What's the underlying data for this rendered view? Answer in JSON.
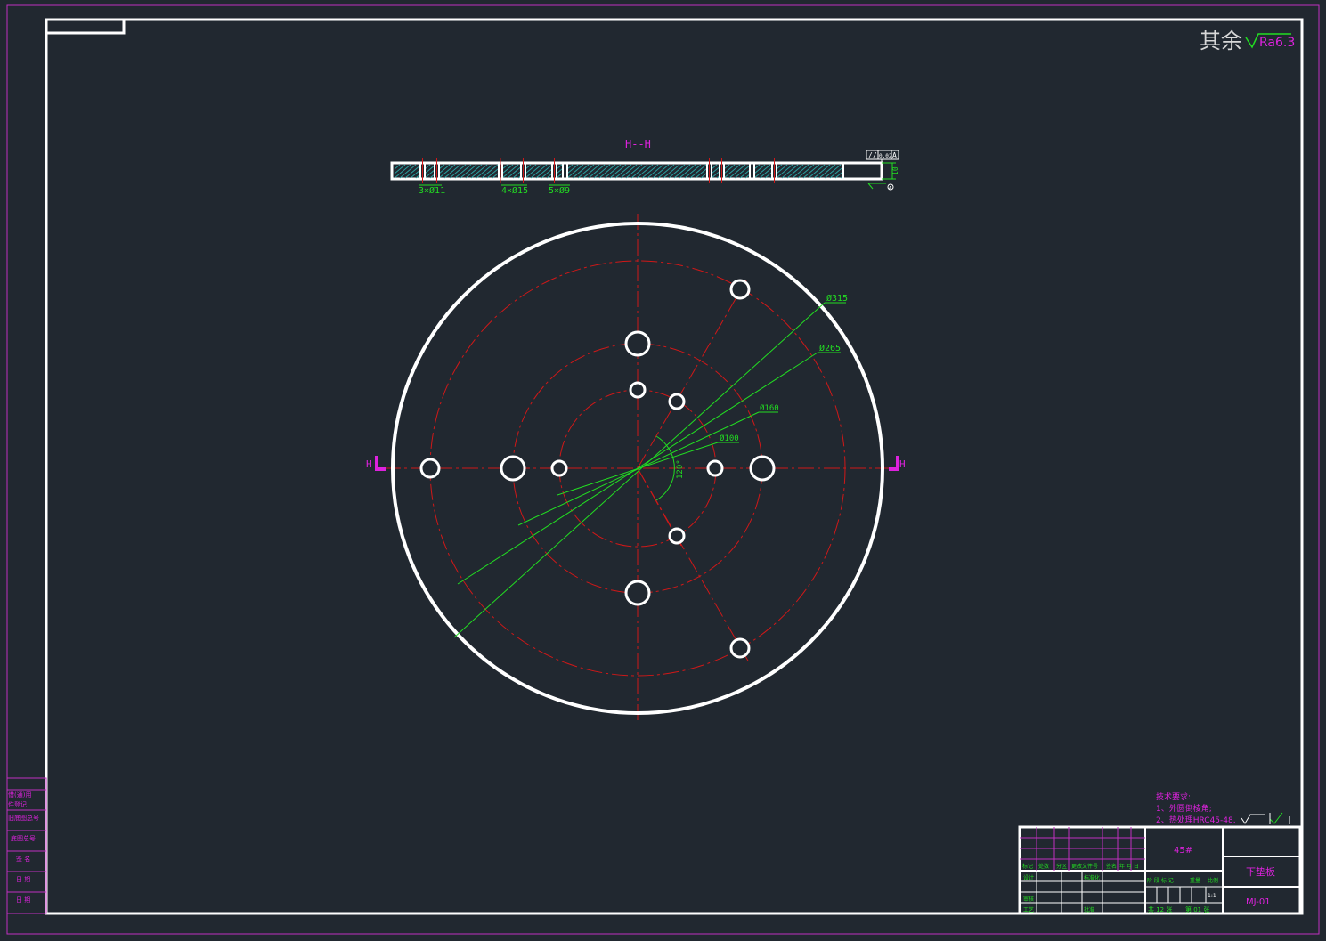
{
  "colors": {
    "background": "#212830",
    "outline": "#ffffff",
    "centerline": "#d01818",
    "dimension": "#22dd22",
    "annotation": "#dd22dd",
    "frame": "#c030c0",
    "hatch": "#2aa0a0"
  },
  "surface_note": {
    "prefix": "其余",
    "value": "Ra6.3"
  },
  "section_view": {
    "label": "H--H",
    "hole_callouts": [
      "3×Ø11",
      "4×Ø15",
      "5×Ø9"
    ],
    "thickness": "10",
    "tolerance_frame": {
      "symbol": "//",
      "value": "0.02",
      "datum": "A"
    },
    "datum_marker": "A"
  },
  "plan_view": {
    "cut_marker": "H",
    "diameters": [
      "Ø315",
      "Ø265",
      "Ø160",
      "Ø100"
    ],
    "angle": "120°"
  },
  "tech_requirements": {
    "title": "技术要求:",
    "items": [
      "1、外圆倒棱角;",
      "2、热处理HRC45-48."
    ]
  },
  "title_block": {
    "material": "45#",
    "part_name": "下垫板",
    "drawing_no": "MJ-01",
    "header_cells": [
      "标记",
      "处数",
      "分区",
      "更改文件号",
      "签名",
      "年 月 日"
    ],
    "row_labels": [
      "设计",
      "审核",
      "工艺"
    ],
    "std_labels": [
      "标准化",
      "批准"
    ],
    "col_labels": [
      "阶 段 标 记",
      "重量",
      "比例"
    ],
    "scale": "1:1",
    "sheets": "共 12 张",
    "sheet_no": "第 01 张"
  },
  "left_strip": [
    "借(通)用",
    "件登记",
    "旧底图总号",
    "底图总号",
    "签 名",
    "日 期",
    "日 期"
  ]
}
